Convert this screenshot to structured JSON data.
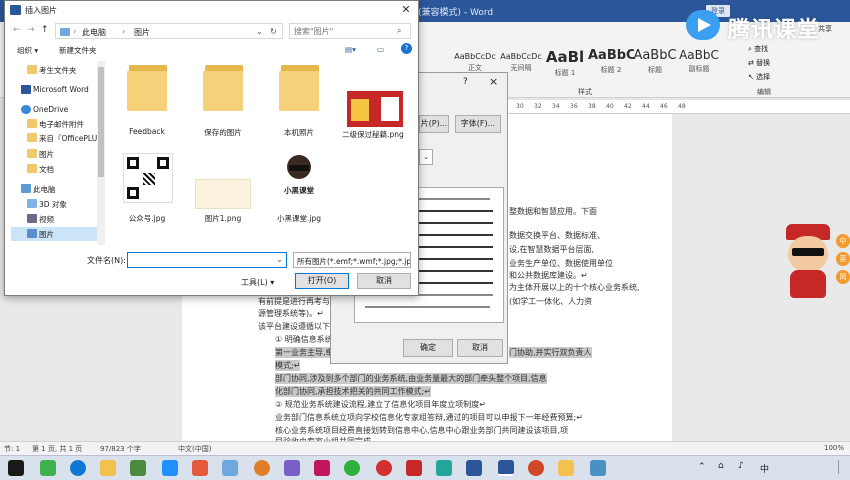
{
  "word": {
    "title_partial": "(兼容模式) - Word",
    "styles": [
      {
        "sample": "AaBbCcDc",
        "name": "正文"
      },
      {
        "sample": "AaBbCcDc",
        "name": "无间隔"
      },
      {
        "sample": "AaBl",
        "name": "标题 1"
      },
      {
        "sample": "AaBbC",
        "name": "标题 2"
      },
      {
        "sample": "AaBbC",
        "name": "标题"
      },
      {
        "sample": "AaBbC",
        "name": "副标题"
      }
    ],
    "ribbon_groups": {
      "styles": "样式",
      "editing": "编辑"
    },
    "editing": {
      "find": "查找",
      "replace": "替换",
      "select": "选择"
    },
    "login": "登录",
    "share": "共享",
    "ruler_ticks": [
      "30",
      "32",
      "34",
      "36",
      "38",
      "40",
      "42",
      "44",
      "46",
      "48"
    ],
    "doc_lines": [
      "整数据和智慧应用。下面",
      "数据交换平台、数据标准、",
      "设,在智慧数据平台层面,",
      "业务生产单位、数据使用单位",
      "和公共数据库建设。↵",
      "为主体开展以上的十个核心业务系统,",
      "有前提是进行再考与开说",
      "(如学工一体化、人力资",
      "源管理系统等)。↵",
      "该平台建设遵循以下思",
      "① 明确信息系统建",
      "第一业务主导,牵",
      "门协助,并实行双负责人",
      "模式;↵",
      "部门协同,涉及到多个部门的业务系统,由业务量最大的部门牵头整个项目,信息",
      "化部门协同,承担技术把关的共同工作模式;↵",
      "② 规范业务系统建设流程,建立了信息化项目年度立项制度↵",
      "业务部门信息系统立项向学校信息化专家组答辩,通过的项目可以申报下一年经费预算;↵",
      "核心业务系统项目经费直接划转到信息中心,信息中心跟业务部门共同建设该项目,项",
      "目验收由专家小组共同完成。"
    ],
    "status": {
      "section": "节: 1",
      "page": "第 1 页, 共 1 页",
      "words": "97/823 个字",
      "language": "中文(中国)",
      "zoom": "100%"
    }
  },
  "logo": {
    "text": "腾讯课堂"
  },
  "bg_dialog": {
    "buttons": {
      "picture": "片(P)...",
      "font": "字体(F)...",
      "ok": "确定",
      "cancel": "取消"
    },
    "help": "?",
    "close": "×"
  },
  "insert_dialog": {
    "title": "插入图片",
    "breadcrumb": [
      "此电脑",
      "图片"
    ],
    "search_placeholder": "搜索\"图片\"",
    "organize": "组织 ▾",
    "new_folder": "新建文件夹",
    "nav_items": [
      {
        "label": "考生文件夹",
        "icon": "folder"
      },
      {
        "label": "Microsoft Word",
        "icon": "word"
      },
      {
        "label": "OneDrive",
        "icon": "cloud"
      },
      {
        "label": "电子邮件附件",
        "icon": "folder"
      },
      {
        "label": "来自『OfficePLU",
        "icon": "folder"
      },
      {
        "label": "图片",
        "icon": "folder"
      },
      {
        "label": "文档",
        "icon": "folder"
      },
      {
        "label": "此电脑",
        "icon": "pc"
      },
      {
        "label": "3D 对象",
        "icon": "cube"
      },
      {
        "label": "视频",
        "icon": "video"
      },
      {
        "label": "图片",
        "icon": "pictures"
      }
    ],
    "files": [
      {
        "name": "Feedback",
        "type": "folder"
      },
      {
        "name": "保存的图片",
        "type": "folder"
      },
      {
        "name": "本机照片",
        "type": "folder"
      },
      {
        "name": "二级保过秘籍.png",
        "type": "image"
      },
      {
        "name": "公众号.jpg",
        "type": "qr"
      },
      {
        "name": "图片1.png",
        "type": "blank"
      },
      {
        "name": "小黑课堂.jpg",
        "type": "avatar"
      }
    ],
    "avatar_caption": "小黑课堂",
    "filename_label": "文件名(N):",
    "filename_value": "",
    "filter": "所有图片(*.emf;*.wmf;*.jpg;*.jp",
    "tools": "工具(L) ▾",
    "open": "打开(O)",
    "cancel": "取消"
  },
  "mascot_buttons": [
    "中",
    "英",
    "简"
  ],
  "taskbar": {
    "time": "",
    "ime": "中"
  }
}
